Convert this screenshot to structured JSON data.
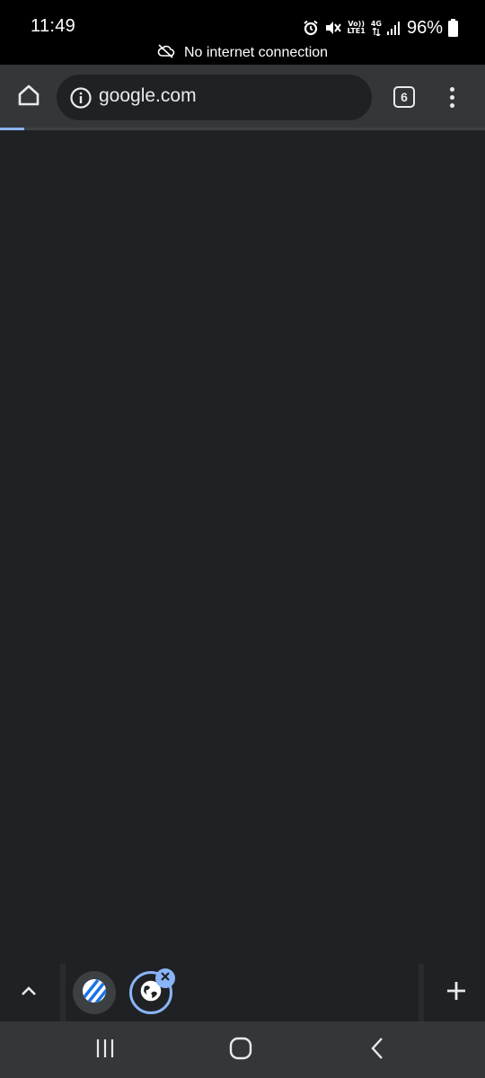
{
  "status_bar": {
    "time": "11:49",
    "battery_percent": "96%",
    "network_volte": "Vo))",
    "network_lte": "LTE1",
    "network_4g": "4G",
    "offline_message": "No internet connection",
    "icons": [
      "alarm-icon",
      "mute-icon",
      "signal-icon",
      "battery-icon",
      "cloud-off-icon"
    ]
  },
  "toolbar": {
    "url": "google.com",
    "tab_count": "6",
    "icons": [
      "home-icon",
      "info-icon",
      "more-vert-icon"
    ]
  },
  "progress": {
    "loaded_fraction": 0.05
  },
  "tab_strip": {
    "tabs": [
      {
        "favicon": "striped-circle-icon",
        "selected": false
      },
      {
        "favicon": "globe-icon",
        "selected": true
      }
    ],
    "icons": [
      "chevron-up-icon",
      "close-icon",
      "plus-icon"
    ]
  },
  "nav_bar": {
    "icons": [
      "recents-icon",
      "home-circle-icon",
      "back-icon"
    ]
  },
  "colors": {
    "accent": "#8ab4f8",
    "toolbar_bg": "#35363a",
    "content_bg": "#202124",
    "status_bg": "#000000"
  }
}
